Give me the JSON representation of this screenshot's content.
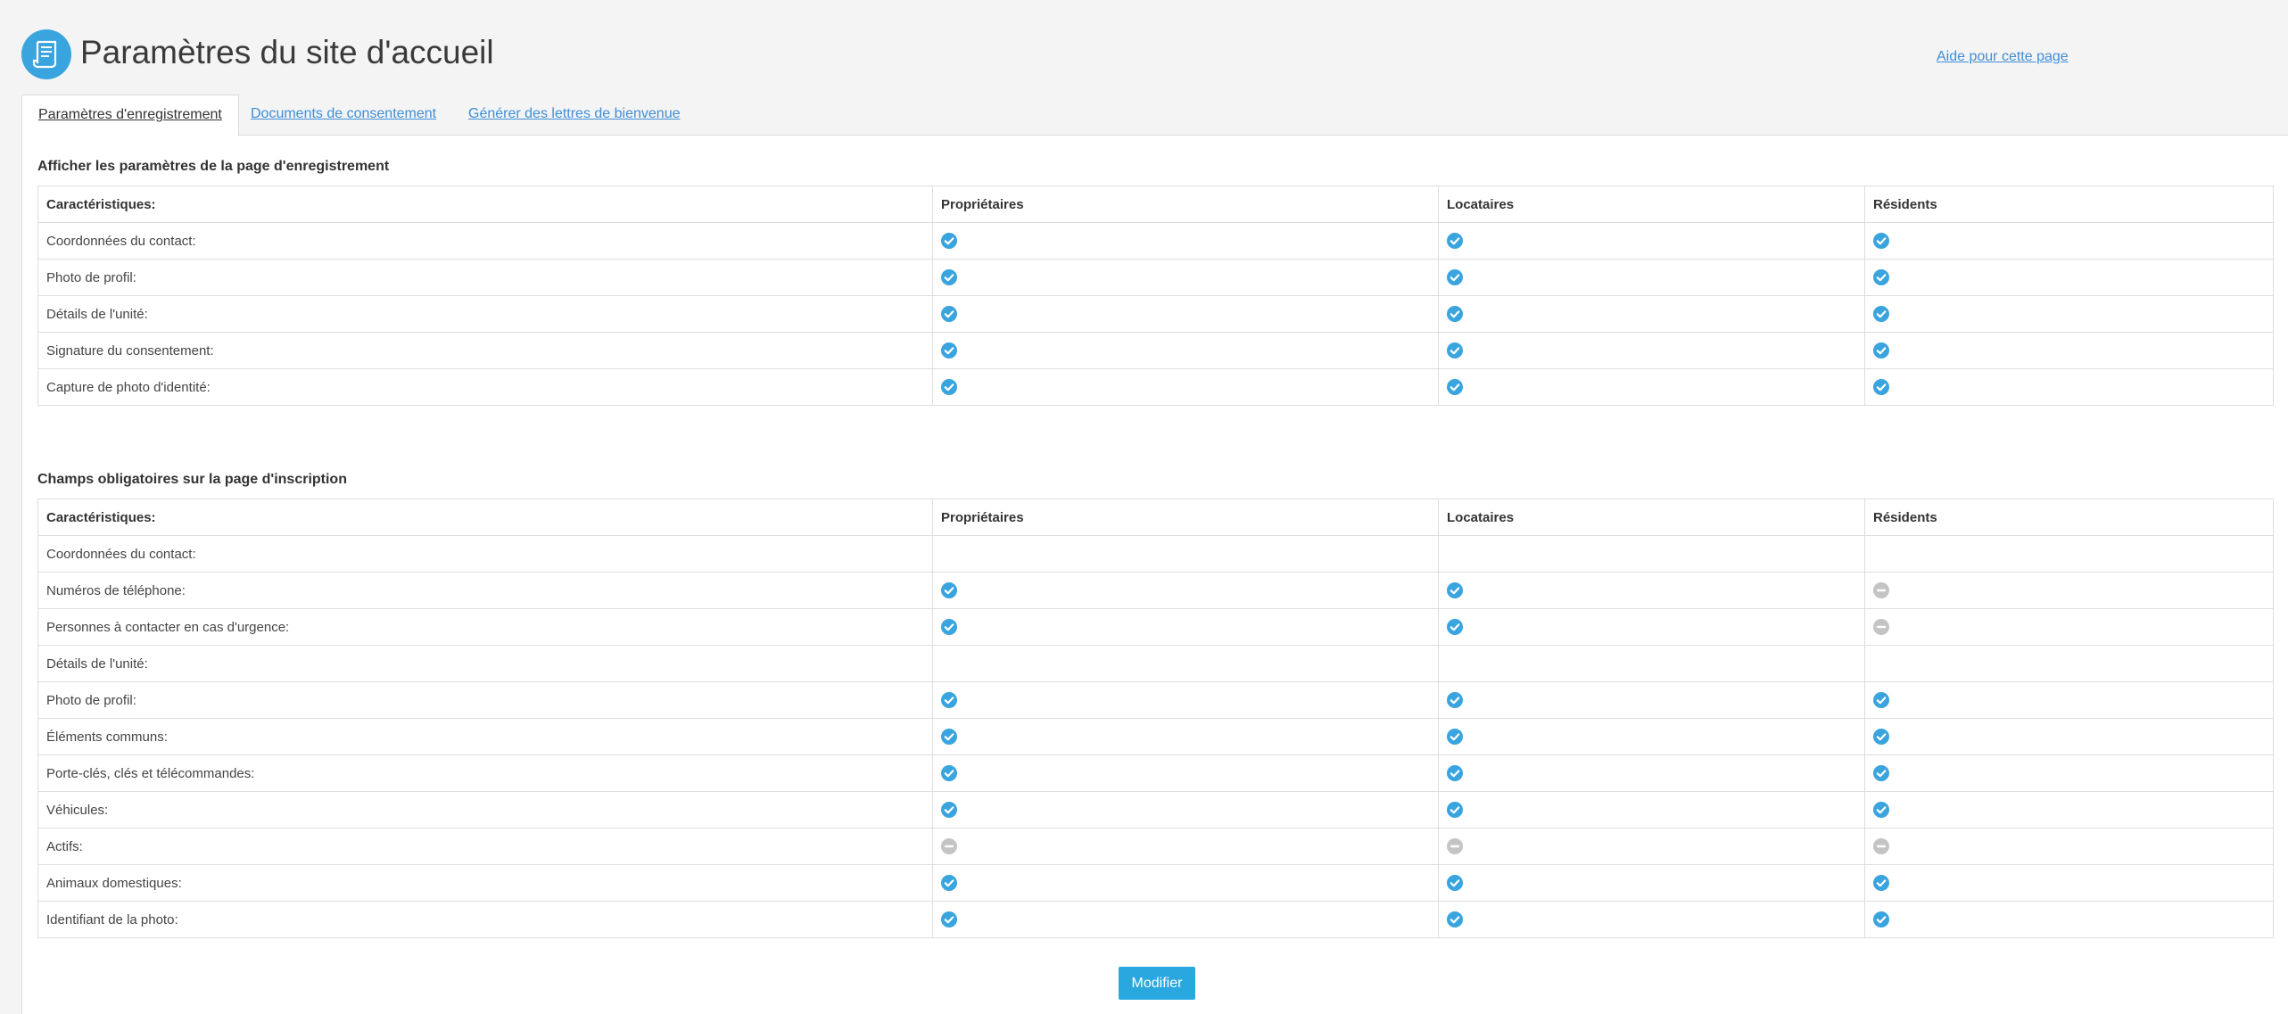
{
  "page": {
    "title": "Paramètres du site d'accueil",
    "help_link": "Aide pour cette page",
    "logo_icon": "document-scroll-icon"
  },
  "tabs": [
    {
      "label": "Paramètres d'enregistrement",
      "active": true
    },
    {
      "label": "Documents de consentement",
      "active": false
    },
    {
      "label": "Générer des lettres de bienvenue",
      "active": false
    }
  ],
  "colors": {
    "accent": "#3aa4de",
    "enabled": "#3aa4de",
    "disabled": "#c4c4c4",
    "link": "#3f8ed6"
  },
  "registration_table": {
    "title": "Afficher les paramètres de la page d'enregistrement",
    "headers": [
      "Caractéristiques:",
      "Propriétaires",
      "Locataires",
      "Résidents"
    ],
    "rows": [
      {
        "label": "Coordonnées du contact:",
        "indent": false,
        "values": [
          "check",
          "check",
          "check"
        ]
      },
      {
        "label": "Photo de profil:",
        "indent": false,
        "values": [
          "check",
          "check",
          "check"
        ]
      },
      {
        "label": "Détails de l'unité:",
        "indent": false,
        "values": [
          "check",
          "check",
          "check"
        ]
      },
      {
        "label": "Signature du consentement:",
        "indent": false,
        "values": [
          "check",
          "check",
          "check"
        ]
      },
      {
        "label": "Capture de photo d'identité:",
        "indent": false,
        "values": [
          "check",
          "check",
          "check"
        ]
      }
    ]
  },
  "required_table": {
    "title": "Champs obligatoires sur la page d'inscription",
    "headers": [
      "Caractéristiques:",
      "Propriétaires",
      "Locataires",
      "Résidents"
    ],
    "rows": [
      {
        "label": "Coordonnées du contact:",
        "indent": false,
        "values": [
          "",
          "",
          ""
        ]
      },
      {
        "label": "Numéros de téléphone:",
        "indent": true,
        "values": [
          "check",
          "check",
          "minus"
        ]
      },
      {
        "label": "Personnes à contacter en cas d'urgence:",
        "indent": true,
        "values": [
          "check",
          "check",
          "minus"
        ]
      },
      {
        "label": "Détails de l'unité:",
        "indent": false,
        "values": [
          "",
          "",
          ""
        ]
      },
      {
        "label": "Photo de profil:",
        "indent": true,
        "values": [
          "check",
          "check",
          "check"
        ]
      },
      {
        "label": "Éléments communs:",
        "indent": true,
        "values": [
          "check",
          "check",
          "check"
        ]
      },
      {
        "label": "Porte-clés, clés et télécommandes:",
        "indent": true,
        "values": [
          "check",
          "check",
          "check"
        ]
      },
      {
        "label": "Véhicules:",
        "indent": true,
        "values": [
          "check",
          "check",
          "check"
        ]
      },
      {
        "label": "Actifs:",
        "indent": true,
        "values": [
          "minus",
          "minus",
          "minus"
        ]
      },
      {
        "label": "Animaux domestiques:",
        "indent": true,
        "values": [
          "check",
          "check",
          "check"
        ]
      },
      {
        "label": "Identifiant de la photo:",
        "indent": false,
        "values": [
          "check",
          "check",
          "check"
        ]
      }
    ]
  },
  "actions": {
    "modify_label": "Modifier"
  }
}
